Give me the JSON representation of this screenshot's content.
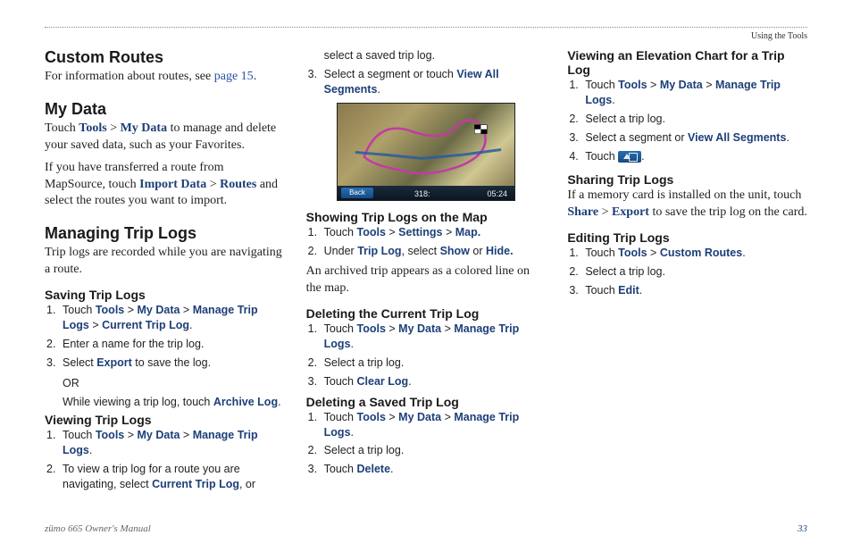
{
  "breadcrumb": "Using the Tools",
  "footer": {
    "left": "zūmo 665 Owner's Manual",
    "page": "33"
  },
  "c1": {
    "h_custom": "Custom Routes",
    "p_custom_a": "For information about routes, see ",
    "p_custom_link": "page 15",
    "p_custom_b": ".",
    "h_mydata": "My Data",
    "p_md_a": "Touch ",
    "ui_tools": "Tools",
    "sep": " > ",
    "ui_mydata": "My Data",
    "p_md_b": " to manage and delete your saved data, such as your Favorites.",
    "p_ms_a": "If you have transferred a route from MapSource, touch ",
    "ui_import": "Import Data",
    "ui_routes": "Routes",
    "p_ms_b": " and select the routes you want to import.",
    "h_manage": "Managing Trip Logs",
    "p_manage": "Trip logs are recorded while you are navigating a route.",
    "h_saving": "Saving Trip Logs",
    "s1_a": "Touch ",
    "s1_tools": "Tools",
    "s1_my": "My Data",
    "s1_mtl": "Manage Trip Logs",
    "s1_ctl": "Current Trip Log",
    "s1_end": ".",
    "s2": "Enter a name for the trip log.",
    "s3_a": "Select ",
    "s3_exp": "Export",
    "s3_b": " to save the log.",
    "s3_or": "OR",
    "s3_c": "While viewing a trip log, touch ",
    "s3_arc": "Archive Log",
    "s3_d": "."
  },
  "c2": {
    "h_view": "Viewing Trip Logs",
    "v1_a": "Touch ",
    "v1_end": ".",
    "v2_a": "To view a trip log for a route you are navigating, select ",
    "v2_ctl": "Current Trip Log",
    "v2_b": ", or select a saved trip log.",
    "v3_a": "Select a segment or touch ",
    "v3_vas": "View All Segments",
    "v3_b": ".",
    "map": {
      "back": "Back",
      "dist": "318:",
      "time": "05:24"
    },
    "h_show": "Showing Trip Logs on the Map",
    "sh1_a": "Touch ",
    "sh1_set": "Settings",
    "sh1_map": "Map.",
    "sh2_a": "Under ",
    "sh2_tl": "Trip Log",
    "sh2_b": ", select ",
    "sh2_show": "Show",
    "sh2_or": " or ",
    "sh2_hide": "Hide.",
    "p_arch": "An archived trip appears as a colored line on the map.",
    "h_delcur": "Deleting the Current Trip Log",
    "d1_a": "Touch ",
    "d1_end": ".",
    "d2": "Select a trip log.",
    "d3_a": "Touch ",
    "d3_cl": "Clear Log",
    "d3_b": "."
  },
  "c3": {
    "h_delsaved": "Deleting a Saved Trip Log",
    "ds1_a": "Touch ",
    "ds1_end": ".",
    "ds2": "Select a trip log.",
    "ds3_a": "Touch ",
    "ds3_del": "Delete",
    "ds3_b": ".",
    "h_elev": "Viewing an Elevation Chart for a Trip Log",
    "e1_a": "Touch ",
    "e1_end": ".",
    "e2": "Select a trip log.",
    "e3_a": "Select a segment or ",
    "e3_vas": "View All Segments",
    "e3_b": ".",
    "e4_a": "Touch ",
    "e4_b": ".",
    "h_share": "Sharing Trip Logs",
    "p_share_a": "If a memory card is installed on the unit, touch ",
    "ui_share": "Share",
    "ui_export": "Export",
    "p_share_b": " to save the trip log on the card.",
    "h_edit": "Editing Trip Logs",
    "ed1_a": "Touch ",
    "ed1_cr": "Custom Routes",
    "ed1_b": ".",
    "ed2": "Select a trip log.",
    "ed3_a": "Touch ",
    "ed3_edit": "Edit",
    "ed3_b": "."
  }
}
